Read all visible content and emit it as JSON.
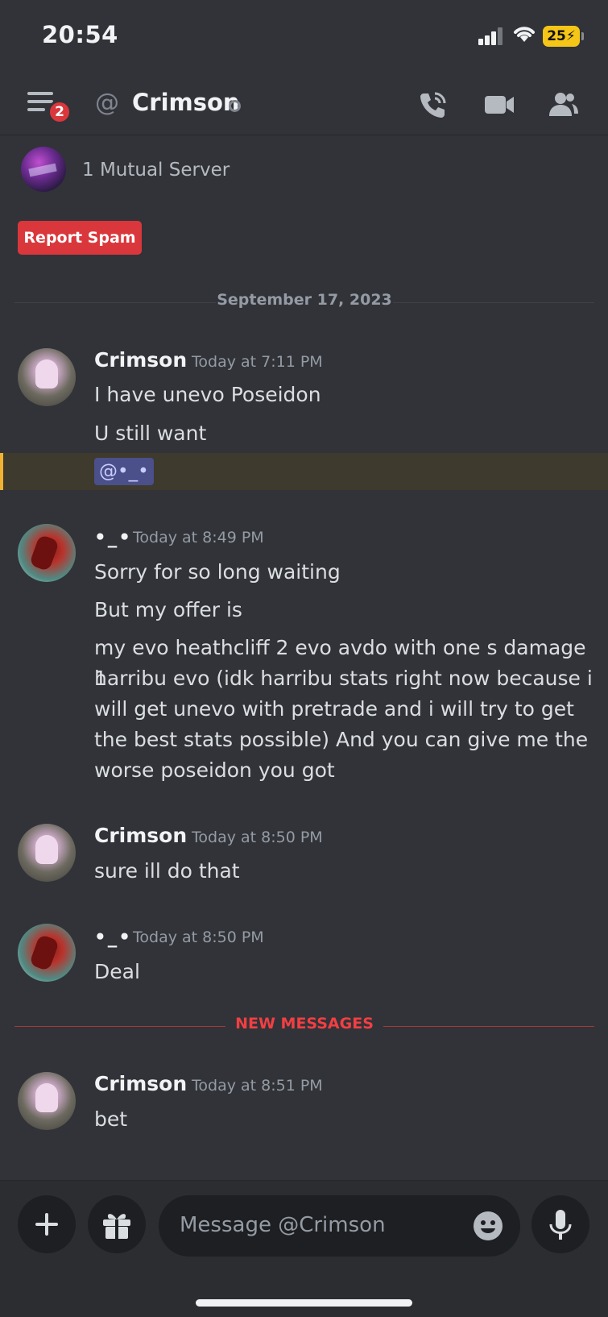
{
  "status_bar": {
    "time": "20:54",
    "battery": "25"
  },
  "header": {
    "badge_count": "2",
    "at_symbol": "@",
    "title": "Crimson",
    "icons": [
      "menu-icon",
      "call-icon",
      "video-icon",
      "members-icon"
    ]
  },
  "profile": {
    "mutual_servers": "1 Mutual Server",
    "report_label": "Report Spam"
  },
  "date_divider": "September 17, 2023",
  "new_messages_label": "NEW MESSAGES",
  "messages": [
    {
      "author": "Crimson",
      "timestamp": "Today at 7:11 PM",
      "lines": [
        "I have unevo Poseidon",
        "U still want"
      ],
      "mention": "@•_•"
    },
    {
      "author": "•_•",
      "timestamp": "Today at 8:49 PM",
      "lines": [
        "Sorry for so long waiting",
        "But my offer is",
        "my evo heathcliff  2 evo avdo with one s damage 1",
        "harribu evo (idk harribu stats right now because i",
        "will get unevo with pretrade and i will try to get",
        "the best stats possible) And you can give me the",
        "worse poseidon you got"
      ]
    },
    {
      "author": "Crimson",
      "timestamp": "Today at 8:50 PM",
      "lines": [
        "sure ill do that"
      ]
    },
    {
      "author": "•_•",
      "timestamp": "Today at 8:50 PM",
      "lines": [
        "Deal"
      ]
    },
    {
      "author": "Crimson",
      "timestamp": "Today at 8:51 PM",
      "lines": [
        "bet"
      ]
    }
  ],
  "composer": {
    "placeholder": "Message @Crimson"
  },
  "colors": {
    "background": "#313338",
    "report": "#da373c",
    "new_messages": "#f23f43",
    "mention_highlight": "#f0b232"
  }
}
